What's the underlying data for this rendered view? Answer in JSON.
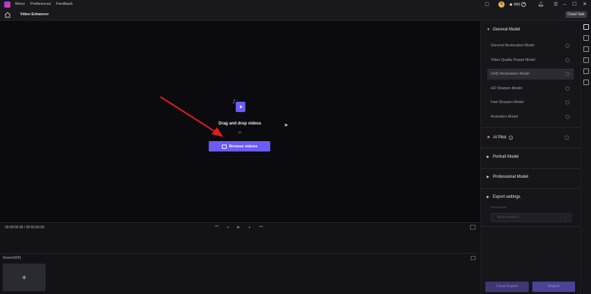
{
  "titlebar": {
    "menu": [
      "Menu",
      "Preferences",
      "Feedback"
    ],
    "credits": "990",
    "avatar_initial": "S"
  },
  "toolbar": {
    "title": "Video Enhancer",
    "cloud_task": "Cloud Task"
  },
  "preview": {
    "drag_text": "Drag and drop videos",
    "or_text": "or",
    "browse_label": "Browse videos"
  },
  "timeline": {
    "timecode": "00:00:00.00 / 00:00:00.00"
  },
  "source": {
    "label": "Source(0/0)",
    "add_symbol": "+"
  },
  "sidebar": {
    "general_model": "General Model",
    "models": [
      {
        "label": "General Restoration Model"
      },
      {
        "label": "Video Quality Repair Model"
      },
      {
        "label": "UHD Restoration Model"
      },
      {
        "label": "HD Sharpen Model"
      },
      {
        "label": "Fast Sharpen Model"
      },
      {
        "label": "Animation Model"
      }
    ],
    "selected_model": "UHD Restoration Model",
    "ai_pilot": "AI Pilot",
    "portrait_model": "Portrait Model",
    "professional_model": "Professional Model",
    "export_settings": "Export settings",
    "resolution_label": "Resolution",
    "resolution_value": "3840*2160(4K)",
    "cloud_export": "Cloud Export",
    "export": "Export"
  },
  "colors": {
    "accent": "#6b5bf7",
    "arrow": "#e01b1b",
    "background": "#0b0b0f"
  }
}
